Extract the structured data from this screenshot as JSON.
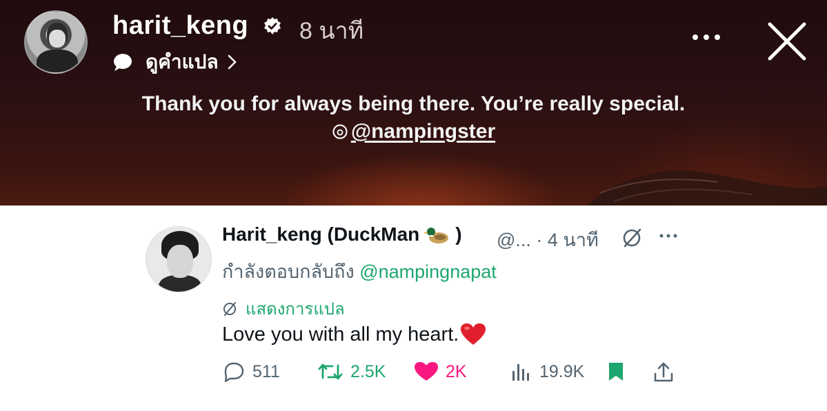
{
  "story": {
    "username": "harit_keng",
    "time": "8 นาที",
    "translate_label": "ดูคำแปล",
    "caption_line1": "Thank you for always being there. You’re really special.",
    "caption_mention": "@nampingster"
  },
  "tweet": {
    "display_name": "Harit_keng (DuckMan",
    "name_suffix": ")",
    "handle_time": "@... · 4 นาที",
    "reply_prefix": "กำลังตอบกลับถึง",
    "reply_mention": "@nampingnapat",
    "show_translation": "แสดงการแปล",
    "text": "Love you with all my heart.",
    "stats": {
      "replies": "511",
      "reposts": "2.5K",
      "likes": "2K",
      "views": "19.9K"
    }
  },
  "colors": {
    "accent_green": "#1da66e",
    "like_pink": "#f91880",
    "secondary_text": "#536471"
  }
}
